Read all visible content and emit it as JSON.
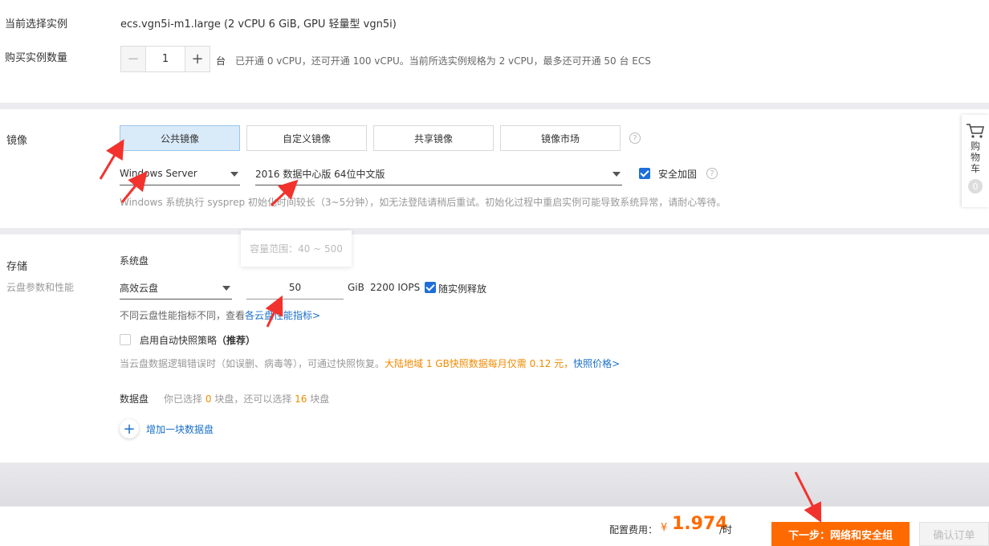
{
  "instance": {
    "current_label": "当前选择实例",
    "current_value": "ecs.vgn5i-m1.large (2 vCPU 6 GiB, GPU 轻量型 vgn5i)",
    "qty_label": "购买实例数量",
    "qty_minus": "−",
    "qty_value": "1",
    "qty_plus": "+",
    "qty_unit": "台",
    "qty_info": "已开通 0 vCPU，还可开通 100 vCPU。当前所选实例规格为 2 vCPU，最多还可开通 50 台 ECS"
  },
  "image": {
    "label": "镜像",
    "tabs": [
      "公共镜像",
      "自定义镜像",
      "共享镜像",
      "镜像市场"
    ],
    "os_select": "Windows Server",
    "version_select": "2016 数据中心版 64位中文版",
    "security_label": "安全加固",
    "note": "Windows 系统执行 sysprep 初始化时间较长（3~5分钟），如无法登陆请稍后重试。初始化过程中重启实例可能导致系统异常，请耐心等待。"
  },
  "cart": {
    "label": "购物车",
    "count": "0"
  },
  "storage": {
    "label": "存储",
    "sublabel": "云盘参数和性能",
    "tooltip": "容量范围：40 ~ 500",
    "system_disk_label": "系统盘",
    "disk_type": "高效云盘",
    "disk_size": "50",
    "disk_unit": "GiB",
    "iops": "2200 IOPS",
    "release_label": "随实例释放",
    "perf_note": "不同云盘性能指标不同，查看",
    "perf_link": "各云盘性能指标>",
    "snapshot_label": "启用自动快照策略",
    "snapshot_recommend": "（推荐）",
    "snapshot_note": "当云盘数据逻辑错误时（如误删、病毒等），可通过快照恢复。",
    "snapshot_price_note": "大陆地域 1 GB快照数据每月仅需 0.12 元，",
    "snapshot_price_link": "快照价格>",
    "data_disk_label": "数据盘",
    "data_disk_info_1": "你已选择",
    "data_disk_selected": "0",
    "data_disk_info_2": "块盘，还可以选择",
    "data_disk_remaining": "16",
    "data_disk_info_3": "块盘",
    "add_disk_label": "增加一块数据盘"
  },
  "footer": {
    "fee_label": "配置费用：",
    "currency": "¥",
    "price": "1.974",
    "unit": "/时",
    "next_button": "下一步：网络和安全组",
    "confirm_button": "确认订单"
  },
  "colors": {
    "accent_orange": "#ff6a00",
    "link_blue": "#1a6fc9",
    "arrow_red": "#f2322d"
  }
}
